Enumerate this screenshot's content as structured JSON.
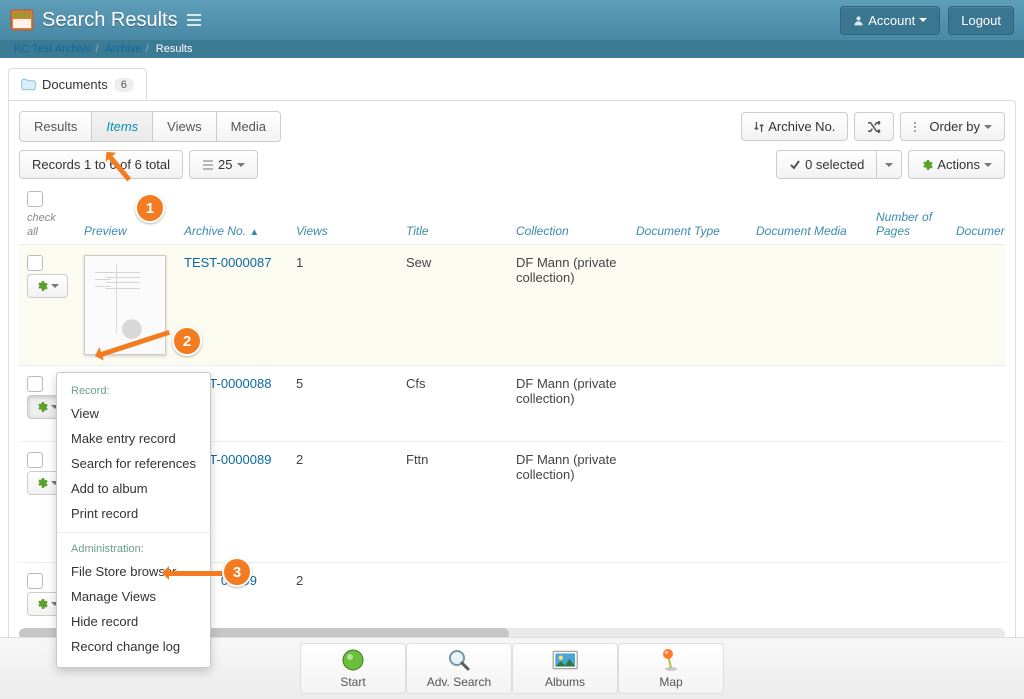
{
  "header": {
    "title": "Search Results",
    "account_label": "Account",
    "logout_label": "Logout"
  },
  "breadcrumb": {
    "a": "KC Test Archive",
    "b": "Archive",
    "c": "Results"
  },
  "docs_tab": {
    "label": "Documents",
    "count": "6"
  },
  "view_tabs": {
    "results": "Results",
    "items": "Items",
    "views": "Views",
    "media": "Media"
  },
  "sort": {
    "by_field": "Archive No.",
    "order_by": "Order by"
  },
  "toolbar": {
    "range": "Records 1 to 6 of 6 total",
    "pagesize": "25",
    "selected": "0 selected",
    "actions": "Actions"
  },
  "columns": {
    "check_all": "check all",
    "preview": "Preview",
    "archive_no": "Archive No.",
    "views": "Views",
    "title": "Title",
    "collection": "Collection",
    "doc_type": "Document Type",
    "doc_media": "Document Media",
    "pages": "Number of Pages",
    "dimen": "Document Dimen"
  },
  "rows": [
    {
      "archive_no": "TEST-0000087",
      "views": "1",
      "title": "Sew",
      "collection": "DF Mann (private collection)"
    },
    {
      "archive_no": "TEST-0000088",
      "views": "5",
      "title": "Cfs",
      "collection": "DF Mann (private collection)"
    },
    {
      "archive_no": "TEST-0000089",
      "views": "2",
      "title": "Fttn",
      "collection": "DF Mann (private collection)"
    },
    {
      "archive_no": "TEST-0000399",
      "views": "2",
      "title": "",
      "collection": ""
    }
  ],
  "menu": {
    "hdr1": "Record:",
    "view": "View",
    "entry": "Make entry record",
    "search": "Search for references",
    "album": "Add to album",
    "print": "Print record",
    "hdr2": "Administration:",
    "fsb": "File Store browser",
    "mv": "Manage Views",
    "hide": "Hide record",
    "log": "Record change log"
  },
  "callouts": {
    "c1": "1",
    "c2": "2",
    "c3": "3"
  },
  "footer": {
    "start": "Start",
    "adv": "Adv. Search",
    "albums": "Albums",
    "map": "Map"
  }
}
